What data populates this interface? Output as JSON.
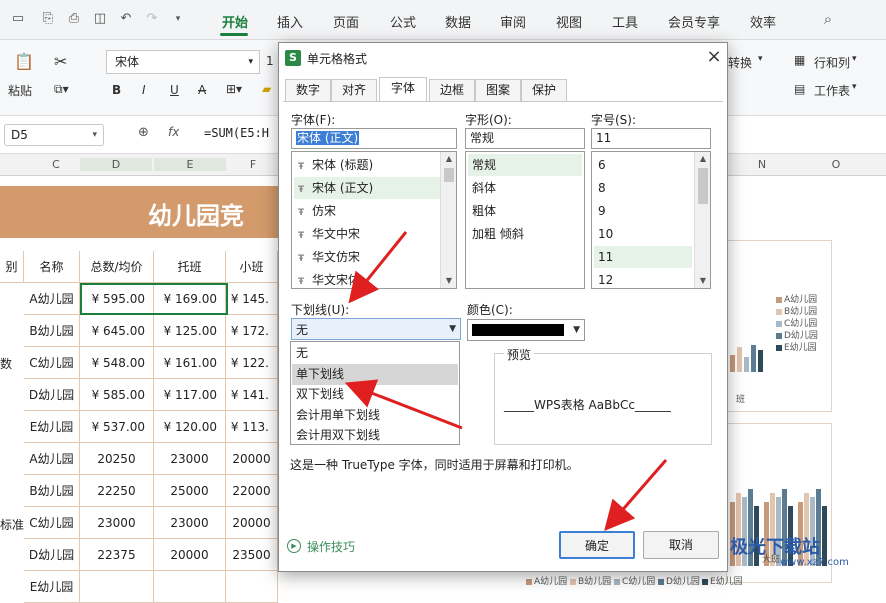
{
  "menu": {
    "items": [
      "开始",
      "插入",
      "页面",
      "公式",
      "数据",
      "审阅",
      "视图",
      "工具",
      "会员专享",
      "效率"
    ],
    "active": "开始"
  },
  "ribbon": {
    "font_name": "宋体",
    "font_size_partial": "1",
    "paste": "粘贴",
    "convert": "转换",
    "rows_cols": "行和列",
    "worksheet": "工作表",
    "bold": "B",
    "italic": "I",
    "underline": "U",
    "strike": "A"
  },
  "formula_bar": {
    "cell_ref": "D5",
    "fx": "fx",
    "formula": "=SUM(E5:H"
  },
  "columns": [
    "C",
    "D",
    "E",
    "F",
    "N",
    "O"
  ],
  "sheet": {
    "title": "幼儿园竞",
    "headers": [
      "别",
      "名称",
      "总数/均价",
      "托班",
      "小班"
    ],
    "side_labels": [
      "数",
      "标准"
    ],
    "rows": [
      [
        "A幼儿园",
        "¥ 595.00",
        "¥ 169.00",
        "¥ 145."
      ],
      [
        "B幼儿园",
        "¥ 645.00",
        "¥ 125.00",
        "¥ 172."
      ],
      [
        "C幼儿园",
        "¥ 548.00",
        "¥ 161.00",
        "¥ 122."
      ],
      [
        "D幼儿园",
        "¥ 585.00",
        "¥ 117.00",
        "¥ 141."
      ],
      [
        "E幼儿园",
        "¥ 537.00",
        "¥ 120.00",
        "¥ 113."
      ],
      [
        "A幼儿园",
        "20250",
        "23000",
        "20000"
      ],
      [
        "B幼儿园",
        "22250",
        "25000",
        "22000"
      ],
      [
        "C幼儿园",
        "23000",
        "23000",
        "20000"
      ],
      [
        "D幼儿园",
        "22375",
        "20000",
        "23500"
      ],
      [
        "E幼儿园",
        "",
        "",
        ""
      ]
    ],
    "legend": [
      "A幼儿园",
      "B幼儿园",
      "C幼儿园",
      "D幼儿园",
      "E幼儿园"
    ],
    "legend_colors": [
      "#c79a7b",
      "#e3c4ad",
      "#a8b9c7",
      "#5b7c91",
      "#2e4a5a"
    ],
    "chart1_xlabel": "班",
    "chart2_xlabel": "大班",
    "bottom_legend": [
      "A幼儿园",
      "B幼儿园",
      "C幼儿园",
      "D幼儿园",
      "E幼儿园"
    ]
  },
  "dialog": {
    "app_icon": "S",
    "title": "单元格格式",
    "close": "×",
    "tabs": [
      "数字",
      "对齐",
      "字体",
      "边框",
      "图案",
      "保护"
    ],
    "active_tab": "字体",
    "font_label": "字体(F):",
    "font_value": "宋体 (正文)",
    "font_list": [
      "宋体 (标题)",
      "宋体 (正文)",
      "仿宋",
      "华文中宋",
      "华文仿宋",
      "华文宋体"
    ],
    "font_selected_index": 1,
    "style_label": "字形(O):",
    "style_value": "常规",
    "style_list": [
      "常规",
      "斜体",
      "粗体",
      "加粗 倾斜"
    ],
    "size_label": "字号(S):",
    "size_value": "11",
    "size_list": [
      "6",
      "8",
      "9",
      "10",
      "11",
      "12"
    ],
    "underline_label": "下划线(U):",
    "underline_value": "无",
    "underline_options": [
      "无",
      "单下划线",
      "双下划线",
      "会计用单下划线",
      "会计用双下划线"
    ],
    "underline_highlight_index": 1,
    "color_label": "颜色(C):",
    "color_value": "#000000",
    "preview_label": "预览",
    "preview_text": "_____WPS表格  AaBbCc______",
    "hint": "这是一种 TrueType 字体，同时适用于屏幕和打印机。",
    "tips": "操作技巧",
    "ok": "确定",
    "cancel": "取消"
  },
  "watermark": {
    "title": "极光下载站",
    "url": "www.xz7.com"
  }
}
